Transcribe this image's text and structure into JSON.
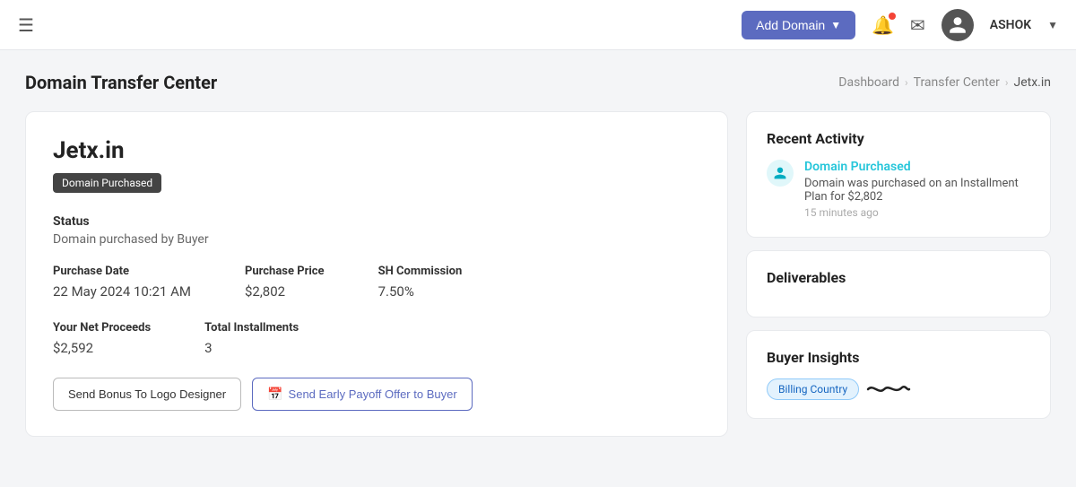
{
  "topnav": {
    "add_domain_label": "Add Domain",
    "user_name": "ASHOK"
  },
  "page": {
    "title": "Domain Transfer Center",
    "breadcrumb": {
      "items": [
        "Dashboard",
        "Transfer Center",
        "Jetx.in"
      ]
    }
  },
  "domain_card": {
    "domain_name": "Jetx.in",
    "status_badge": "Domain Purchased",
    "status_label": "Status",
    "status_value": "Domain purchased by Buyer",
    "purchase_date_label": "Purchase Date",
    "purchase_date_value": "22 May 2024",
    "purchase_date_time": "10:21 AM",
    "purchase_price_label": "Purchase Price",
    "purchase_price_value": "$2,802",
    "sh_commission_label": "SH Commission",
    "sh_commission_value": "7.50%",
    "net_proceeds_label": "Your Net Proceeds",
    "net_proceeds_value": "$2,592",
    "total_installments_label": "Total Installments",
    "total_installments_value": "3",
    "btn_bonus": "Send Bonus To Logo Designer",
    "btn_payoff": "Send Early Payoff Offer to Buyer"
  },
  "recent_activity": {
    "title": "Recent Activity",
    "item": {
      "icon": "👤",
      "title": "Domain Purchased",
      "description": "Domain was purchased on an Installment Plan for $2,802",
      "time": "15 minutes ago"
    }
  },
  "deliverables": {
    "title": "Deliverables"
  },
  "buyer_insights": {
    "title": "Buyer Insights",
    "tag1": "Billing Country"
  }
}
